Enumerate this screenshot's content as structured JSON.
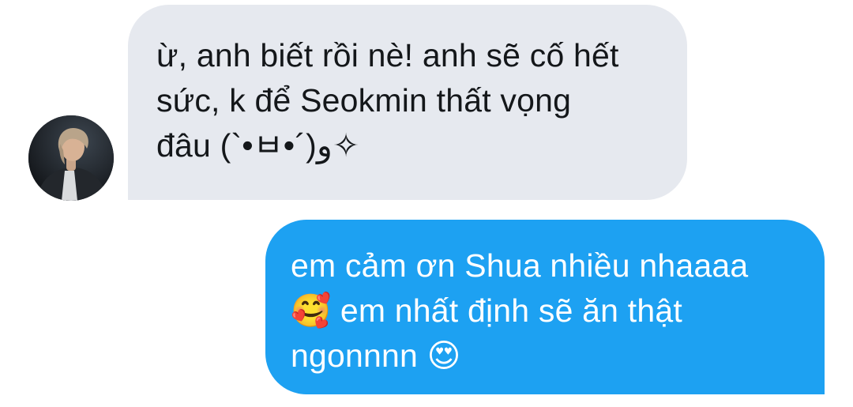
{
  "conversation": {
    "incoming": {
      "lines": [
        "ừ, anh biết rồi nè! anh sẽ cố hết",
        "sức, k để Seokmin thất vọng",
        "đâu (`•ㅂ•´)و✧"
      ]
    },
    "outgoing": {
      "lines": [
        "em cảm ơn Shua nhiều nhaaaa",
        "🥰 em nhất định sẽ ăn thật",
        "ngonnnn 😍"
      ]
    }
  },
  "colors": {
    "incoming_bubble": "#e6e9ef",
    "outgoing_bubble": "#1da1f2",
    "incoming_text": "#14171a",
    "outgoing_text": "#ffffff",
    "background": "#ffffff"
  }
}
